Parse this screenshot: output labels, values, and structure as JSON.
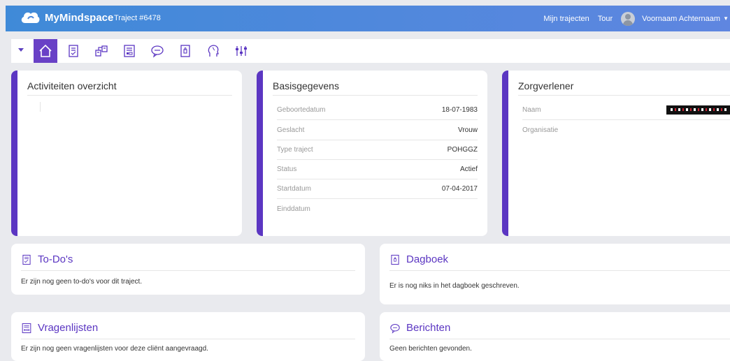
{
  "header": {
    "brand": "MyMindspace",
    "traject": "Traject #6478",
    "nav": {
      "trajecten": "Mijn trajecten",
      "tour": "Tour"
    },
    "user": "Voornaam Achternaam",
    "gradient": [
      "#3f8ad8",
      "#5f86e0"
    ]
  },
  "toolbar": {
    "icons": [
      "home-icon",
      "todo-icon",
      "network-icon",
      "questionnaire-icon",
      "chat-icon",
      "diary-icon",
      "head-icon",
      "sliders-icon"
    ],
    "accent": "#6941c6"
  },
  "activities": {
    "title": "Activiteiten overzicht"
  },
  "basis": {
    "title": "Basisgegevens",
    "rows": [
      {
        "label": "Geboortedatum",
        "value": "18-07-1983"
      },
      {
        "label": "Geslacht",
        "value": "Vrouw"
      },
      {
        "label": "Type traject",
        "value": "POHGGZ"
      },
      {
        "label": "Status",
        "value": "Actief"
      },
      {
        "label": "Startdatum",
        "value": "07-04-2017"
      },
      {
        "label": "Einddatum",
        "value": ""
      }
    ]
  },
  "zorg": {
    "title": "Zorgverlener",
    "rows": [
      {
        "label": "Naam"
      },
      {
        "label": "Organisatie"
      }
    ]
  },
  "todos": {
    "title": "To-Do's",
    "text": "Er zijn nog geen to-do's voor dit traject."
  },
  "dagboek": {
    "title": "Dagboek",
    "text": "Er is nog niks in het dagboek geschreven."
  },
  "vragenlijsten": {
    "title": "Vragenlijsten",
    "text": "Er zijn nog geen vragenlijsten voor deze cliënt aangevraagd."
  },
  "berichten": {
    "title": "Berichten",
    "text": "Geen berichten gevonden."
  }
}
